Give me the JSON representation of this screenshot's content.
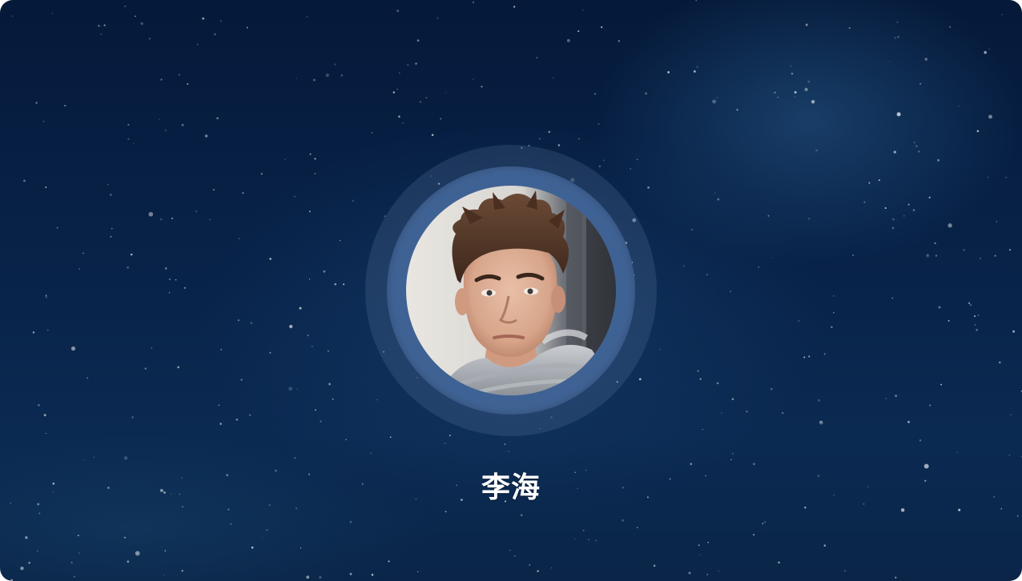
{
  "user": {
    "name": "李海"
  },
  "avatar": {
    "description_icon": "user-photo"
  },
  "colors": {
    "background_dark": "#051a3a",
    "background_mid": "#0b2a52",
    "ring_inner": "#3f6294",
    "name_text": "#ffffff"
  }
}
